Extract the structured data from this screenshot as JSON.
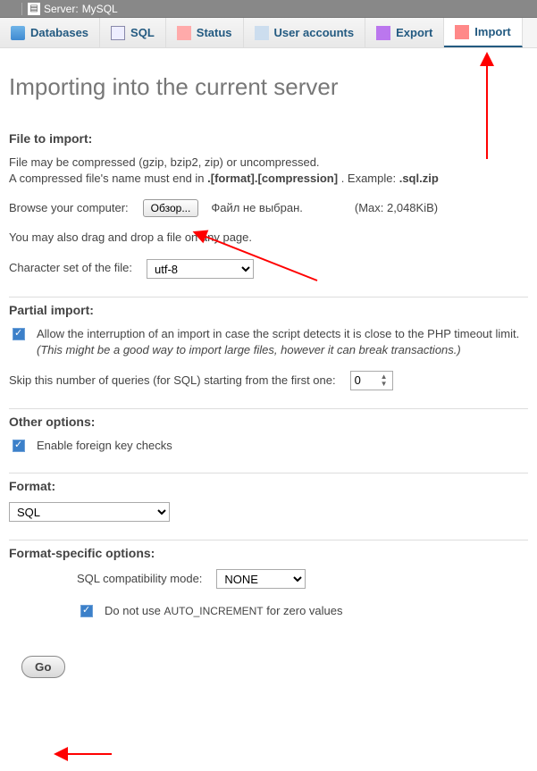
{
  "titlebar": {
    "server_label": "Server:",
    "server_name": "MySQL"
  },
  "tabs": {
    "databases": "Databases",
    "sql": "SQL",
    "status": "Status",
    "users": "User accounts",
    "export": "Export",
    "import": "Import"
  },
  "page": {
    "heading": "Importing into the current server"
  },
  "file": {
    "section": "File to import:",
    "compress_note1": "File may be compressed (gzip, bzip2, zip) or uncompressed.",
    "compress_note2a": "A compressed file's name must end in ",
    "compress_note2b": ".[format].[compression]",
    "compress_note2c": ". Example: ",
    "compress_note2d": ".sql.zip",
    "browse_label": "Browse your computer:",
    "browse_button": "Обзор...",
    "no_file": "Файл не выбран.",
    "max": "(Max: 2,048KiB)",
    "drag_note": "You may also drag and drop a file on any page.",
    "charset_label": "Character set of the file:",
    "charset_value": "utf-8"
  },
  "partial": {
    "section": "Partial import:",
    "allow_label": "Allow the interruption of an import in case the script detects it is close to the PHP timeout limit. ",
    "allow_tail_em": "(This might be a good way to import large files, however it can break transactions.)",
    "skip_label": "Skip this number of queries (for SQL) starting from the first one:",
    "skip_value": "0"
  },
  "other": {
    "section": "Other options:",
    "fk_label": "Enable foreign key checks"
  },
  "format": {
    "section": "Format:",
    "value": "SQL"
  },
  "specific": {
    "section": "Format-specific options:",
    "compat_label": "SQL compatibility mode:",
    "compat_value": "NONE",
    "noautoinc_a": "Do not use ",
    "noautoinc_code": "AUTO_INCREMENT",
    "noautoinc_b": " for zero values"
  },
  "go": {
    "label": "Go"
  }
}
